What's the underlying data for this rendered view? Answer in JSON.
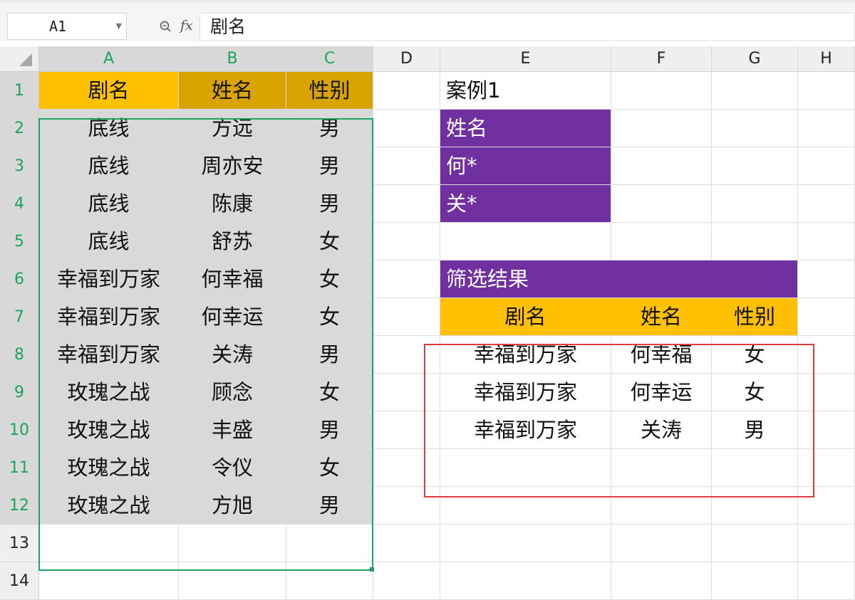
{
  "formula_bar": {
    "cell_ref": "A1",
    "fx_label": "fx",
    "content": "剧名"
  },
  "columns": [
    "A",
    "B",
    "C",
    "D",
    "E",
    "F",
    "G",
    "H"
  ],
  "rows": [
    "1",
    "2",
    "3",
    "4",
    "5",
    "6",
    "7",
    "8",
    "9",
    "10",
    "11",
    "12",
    "13",
    "14"
  ],
  "source_table": {
    "headers": [
      "剧名",
      "姓名",
      "性别"
    ],
    "rows": [
      [
        "底线",
        "方远",
        "男"
      ],
      [
        "底线",
        "周亦安",
        "男"
      ],
      [
        "底线",
        "陈康",
        "男"
      ],
      [
        "底线",
        "舒苏",
        "女"
      ],
      [
        "幸福到万家",
        "何幸福",
        "女"
      ],
      [
        "幸福到万家",
        "何幸运",
        "女"
      ],
      [
        "幸福到万家",
        "关涛",
        "男"
      ],
      [
        "玫瑰之战",
        "顾念",
        "女"
      ],
      [
        "玫瑰之战",
        "丰盛",
        "男"
      ],
      [
        "玫瑰之战",
        "令仪",
        "女"
      ],
      [
        "玫瑰之战",
        "方旭",
        "男"
      ]
    ]
  },
  "criteria": {
    "title": "案例1",
    "header": "姓名",
    "values": [
      "何*",
      "关*"
    ]
  },
  "result": {
    "title": "筛选结果",
    "headers": [
      "剧名",
      "姓名",
      "性别"
    ],
    "rows": [
      [
        "幸福到万家",
        "何幸福",
        "女"
      ],
      [
        "幸福到万家",
        "何幸运",
        "女"
      ],
      [
        "幸福到万家",
        "关涛",
        "男"
      ]
    ]
  },
  "colors": {
    "header_yellow": "#ffc000",
    "header_gold": "#d9a400",
    "data_gray": "#d9d9d9",
    "purple": "#7030a0",
    "selection_green": "#1fa363",
    "highlight_red": "#e23b3b"
  }
}
